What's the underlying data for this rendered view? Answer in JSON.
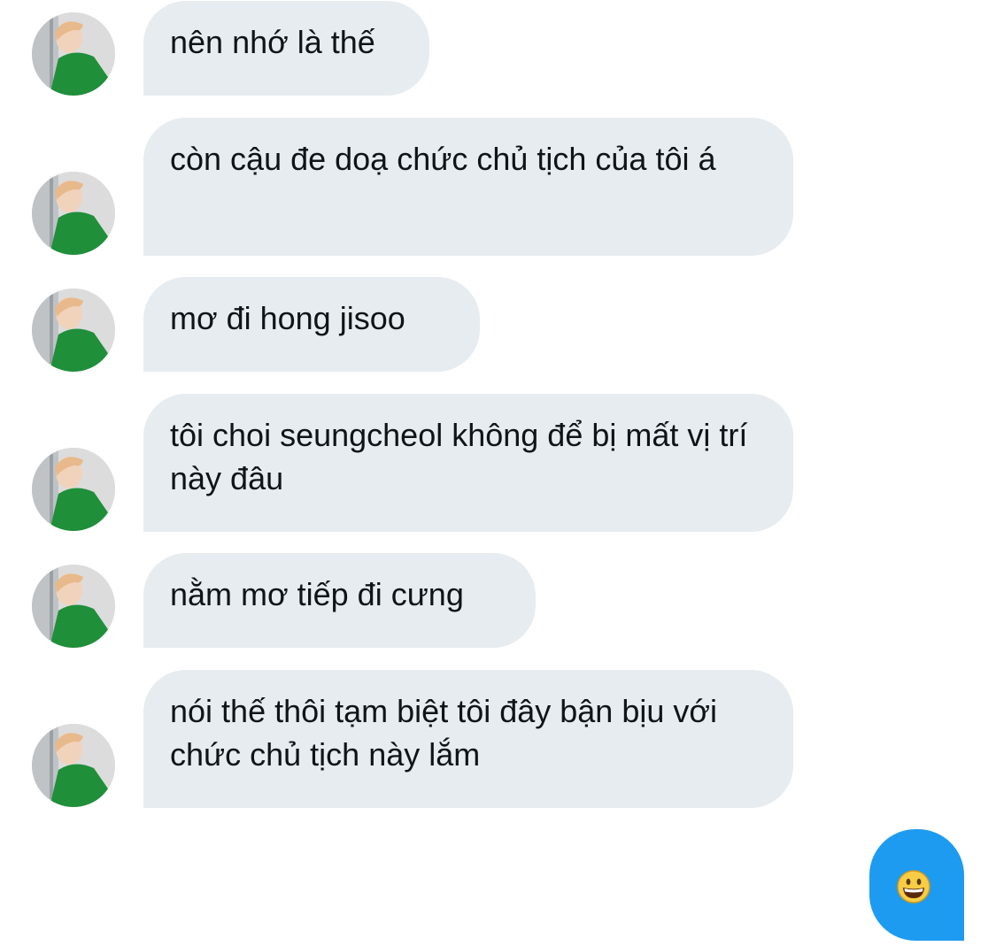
{
  "conversation": {
    "messages": [
      {
        "sender": "other",
        "text": "nên nhớ là thế"
      },
      {
        "sender": "other",
        "text": "còn cậu đe doạ chức chủ tịch của tôi á"
      },
      {
        "sender": "other",
        "text": "mơ đi hong jisoo"
      },
      {
        "sender": "other",
        "text": "tôi choi seungcheol không để bị mất vị trí này đâu"
      },
      {
        "sender": "other",
        "text": "nằm mơ tiếp đi cưng"
      },
      {
        "sender": "other",
        "text": "nói thế thôi tạm biệt tôi đây bận bịu với chức chủ tịch này lắm"
      }
    ],
    "sent_reply": {
      "icon": "grinning-face-emoji"
    }
  },
  "colors": {
    "received_bubble": "#e7ecf0",
    "sent_bubble": "#1d9bf0",
    "text": "#0f1419",
    "avatar_shirt": "#1f8f3a",
    "avatar_hair": "#e8b98a"
  }
}
